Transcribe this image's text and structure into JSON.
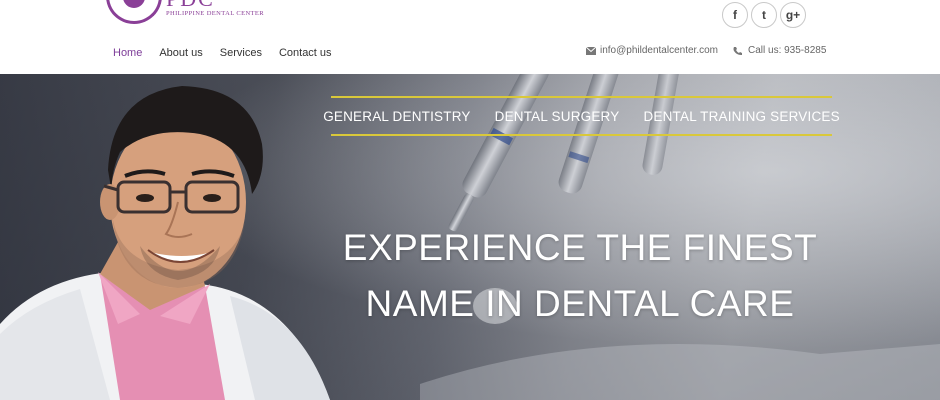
{
  "brand": {
    "logo_text": "PDC",
    "logo_subtitle": "PHILIPPINE DENTAL CENTER"
  },
  "social": [
    {
      "icon": "facebook-icon",
      "glyph": "f"
    },
    {
      "icon": "twitter-icon",
      "glyph": "t"
    },
    {
      "icon": "google-plus-icon",
      "glyph": "g+"
    }
  ],
  "nav": {
    "items": [
      {
        "label": "Home",
        "active": true
      },
      {
        "label": "About us",
        "active": false
      },
      {
        "label": "Services",
        "active": false
      },
      {
        "label": "Contact us",
        "active": false
      }
    ]
  },
  "contact": {
    "email": "info@phildentalcenter.com",
    "phone": "Call us: 935-8285"
  },
  "hero": {
    "services": [
      "GENERAL DENTISTRY",
      "DENTAL SURGERY",
      "DENTAL TRAINING SERVICES"
    ],
    "headline_line1": "EXPERIENCE THE FINEST",
    "headline_line2": "NAME IN DENTAL CARE"
  },
  "colors": {
    "brand_purple": "#7d3c98",
    "rule_yellow": "#d9c83a"
  }
}
